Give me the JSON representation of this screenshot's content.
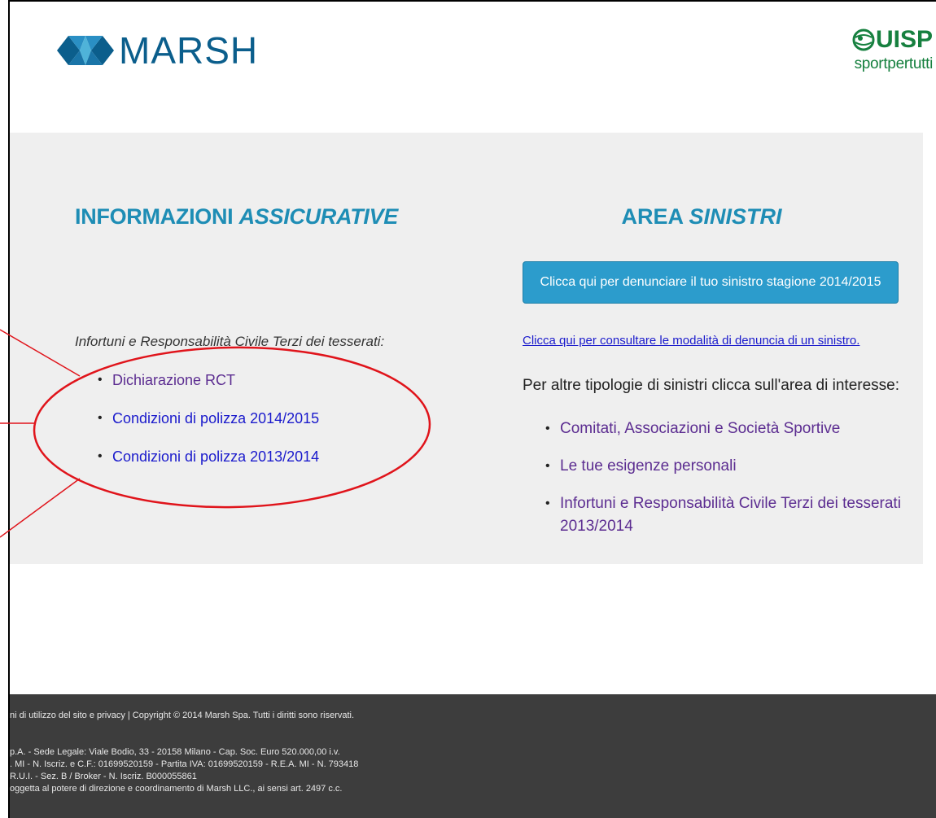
{
  "header": {
    "marsh_logo_text": "MARSH",
    "uisp_logo_text": "UISP",
    "uisp_tagline": "sportpertutti"
  },
  "left": {
    "heading_main": "INFORMAZIONI ",
    "heading_em": "ASSICURATIVE",
    "intro": "Infortuni e Responsabilità Civile Terzi dei tesserati:",
    "links": [
      "Dichiarazione RCT",
      "Condizioni di polizza 2014/2015",
      "Condizioni di polizza 2013/2014"
    ]
  },
  "right": {
    "heading_main": "AREA ",
    "heading_em": "SINISTRI",
    "button_label": "Clicca qui per denunciare il tuo sinistro stagione 2014/2015",
    "modalita_link": "Clicca qui per consultare le modalità di denuncia di un sinistro.",
    "altre_text": "Per altre tipologie di sinistri clicca sull'area di interesse:",
    "links": [
      "Comitati, Associazioni e Società Sportive",
      "Le tue esigenze personali",
      "Infortuni e Responsabilità Civile Terzi dei tesserati 2013/2014"
    ]
  },
  "footer": {
    "line1": "ni di utilizzo del sito e privacy | Copyright © 2014 Marsh Spa. Tutti i diritti sono riservati.",
    "line2": "p.A. - Sede Legale: Viale Bodio, 33 - 20158 Milano - Cap. Soc. Euro 520.000,00 i.v.",
    "line3": ". MI - N. Iscriz. e C.F.: 01699520159 - Partita IVA: 01699520159 - R.E.A. MI - N. 793418",
    "line4": " R.U.I. - Sez. B / Broker - N. Iscriz. B000055861",
    "line5": "oggetta al potere di direzione e coordinamento di Marsh LLC., ai sensi art. 2497 c.c."
  },
  "colors": {
    "heading": "#1e8db5",
    "button": "#2c9ccc",
    "annotation": "#e0141b",
    "footer_bg": "#3d3d3d",
    "panel_bg": "#efefef"
  }
}
